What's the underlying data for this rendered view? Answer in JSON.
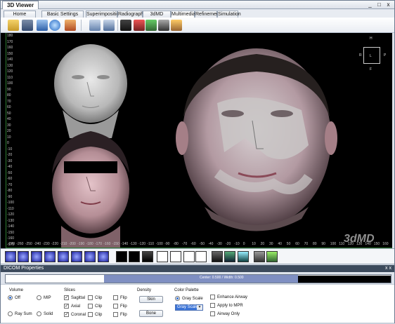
{
  "window": {
    "title": "3D Viewer",
    "controls": [
      "_",
      "□",
      "x"
    ]
  },
  "tabs": [
    {
      "label": "Home",
      "active": false
    },
    {
      "label": "Basic Settings",
      "active": false
    },
    {
      "label": "Superimposition",
      "active": false
    },
    {
      "label": "Radiography",
      "active": false
    },
    {
      "label": "3dMD Analysis",
      "active": false
    },
    {
      "label": "Multimedia",
      "active": true
    },
    {
      "label": "Refinement",
      "active": false
    },
    {
      "label": "Simulation",
      "active": false
    }
  ],
  "toolbar_icons": [
    "open-folder-icon",
    "save-icon",
    "screenshot-icon",
    "refresh-icon",
    "user-settings-icon",
    "print-icon",
    "export-icon",
    "camera-icon",
    "record-icon",
    "play-icon",
    "film-icon",
    "movie-icon"
  ],
  "viewport": {
    "y_ticks": [
      "180",
      "170",
      "160",
      "150",
      "140",
      "130",
      "120",
      "110",
      "100",
      "90",
      "80",
      "70",
      "60",
      "50",
      "40",
      "30",
      "20",
      "10",
      "0",
      "-10",
      "-20",
      "-30",
      "-40",
      "-50",
      "-60",
      "-70",
      "-80",
      "-90",
      "-100",
      "-110",
      "-120",
      "-130",
      "-140",
      "-150",
      "-160",
      "-170"
    ],
    "x_ticks": [
      "-270",
      "-260",
      "-250",
      "-240",
      "-230",
      "-220",
      "-210",
      "-200",
      "-190",
      "-180",
      "-170",
      "-160",
      "-150",
      "-140",
      "-130",
      "-120",
      "-110",
      "-100",
      "-90",
      "-80",
      "-70",
      "-60",
      "-50",
      "-40",
      "-30",
      "-20",
      "-10",
      "0",
      "10",
      "20",
      "30",
      "40",
      "50",
      "60",
      "70",
      "80",
      "90",
      "100",
      "110",
      "120",
      "130",
      "140",
      "150",
      "160"
    ],
    "orientation": {
      "top": "H",
      "left": "R",
      "right": "P",
      "center": "L",
      "bottom": "F"
    },
    "watermark": "3dMD"
  },
  "dicom_panel": {
    "title": "DICOM Properties",
    "header_buttons": [
      "x",
      "x"
    ],
    "histogram_label": "Center: 0.500 / Width: 0.500",
    "volume": {
      "title": "Volume",
      "options": [
        {
          "label": "Off",
          "checked": true
        },
        {
          "label": "MIP",
          "checked": false
        },
        {
          "label": "Ray Sum",
          "checked": false
        },
        {
          "label": "Solid",
          "checked": false
        }
      ]
    },
    "slices": {
      "title": "Slices",
      "rows": [
        {
          "label": "Sagittal",
          "checked": true,
          "clip": "Clip",
          "flip": "Flip"
        },
        {
          "label": "Axial",
          "checked": true,
          "clip": "Clip",
          "flip": "Flip"
        },
        {
          "label": "Coronal",
          "checked": true,
          "clip": "Clip",
          "flip": "Flip"
        }
      ]
    },
    "density": {
      "title": "Density",
      "skin_button": "Skin",
      "bone_button": "Bone"
    },
    "color_palette": {
      "title": "Color Palette",
      "radio_label": "Gray Scale",
      "combo_value": "Gray Scale"
    },
    "options": [
      {
        "label": "Enhance Airway",
        "checked": false
      },
      {
        "label": "Apply to MPR",
        "checked": false
      },
      {
        "label": "Airway Only",
        "checked": false
      }
    ]
  },
  "colors": {
    "accent": "#2f6dd0",
    "ruler_green": "#2e7d32",
    "panel_header": "#3c4a5c"
  }
}
